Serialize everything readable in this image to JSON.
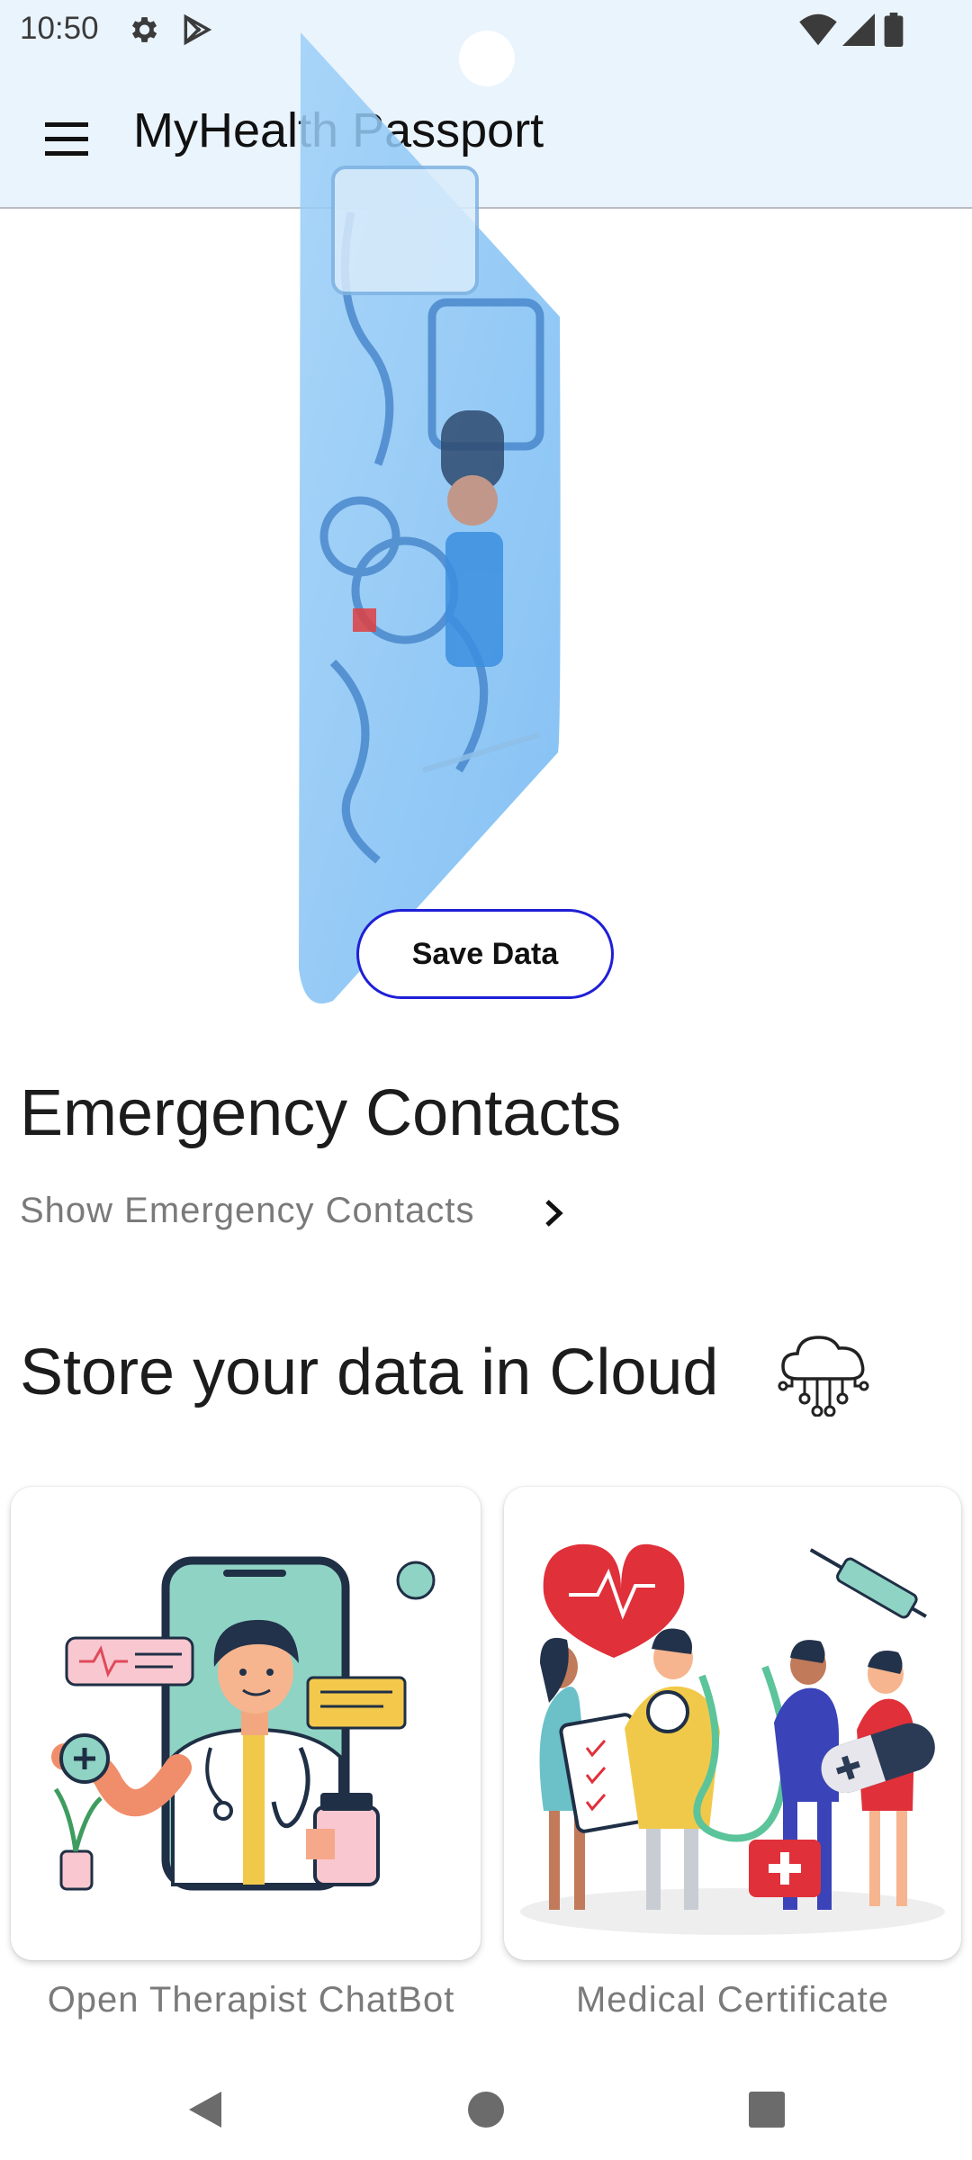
{
  "status_bar": {
    "time": "10:50",
    "icons": [
      "settings-gear-icon",
      "play-store-icon",
      "wifi-icon",
      "signal-icon",
      "battery-icon"
    ]
  },
  "app_bar": {
    "menu_icon": "hamburger-menu-icon",
    "title": "MyHealth Passport"
  },
  "hero": {
    "image": "health-card-illustration",
    "save_button_label": "Save Data"
  },
  "emergency": {
    "title": "Emergency Contacts",
    "link_label": "Show Emergency Contacts",
    "link_icon": "chevron-right-icon"
  },
  "cloud": {
    "title": "Store your data in Cloud",
    "icon": "cloud-circuit-icon"
  },
  "cards": [
    {
      "label": "Open Therapist ChatBot",
      "image": "doctor-phone-illustration"
    },
    {
      "label": "Medical Certificate",
      "image": "medical-team-illustration"
    }
  ],
  "nav_bar": {
    "icons": [
      "back-triangle-icon",
      "home-circle-icon",
      "recents-square-icon"
    ]
  },
  "colors": {
    "app_bar_bg": "#eaf4fd",
    "button_border": "#1f1fd6",
    "secondary_text": "#7a7a7a",
    "hero_blue": "#6fb6f2"
  }
}
